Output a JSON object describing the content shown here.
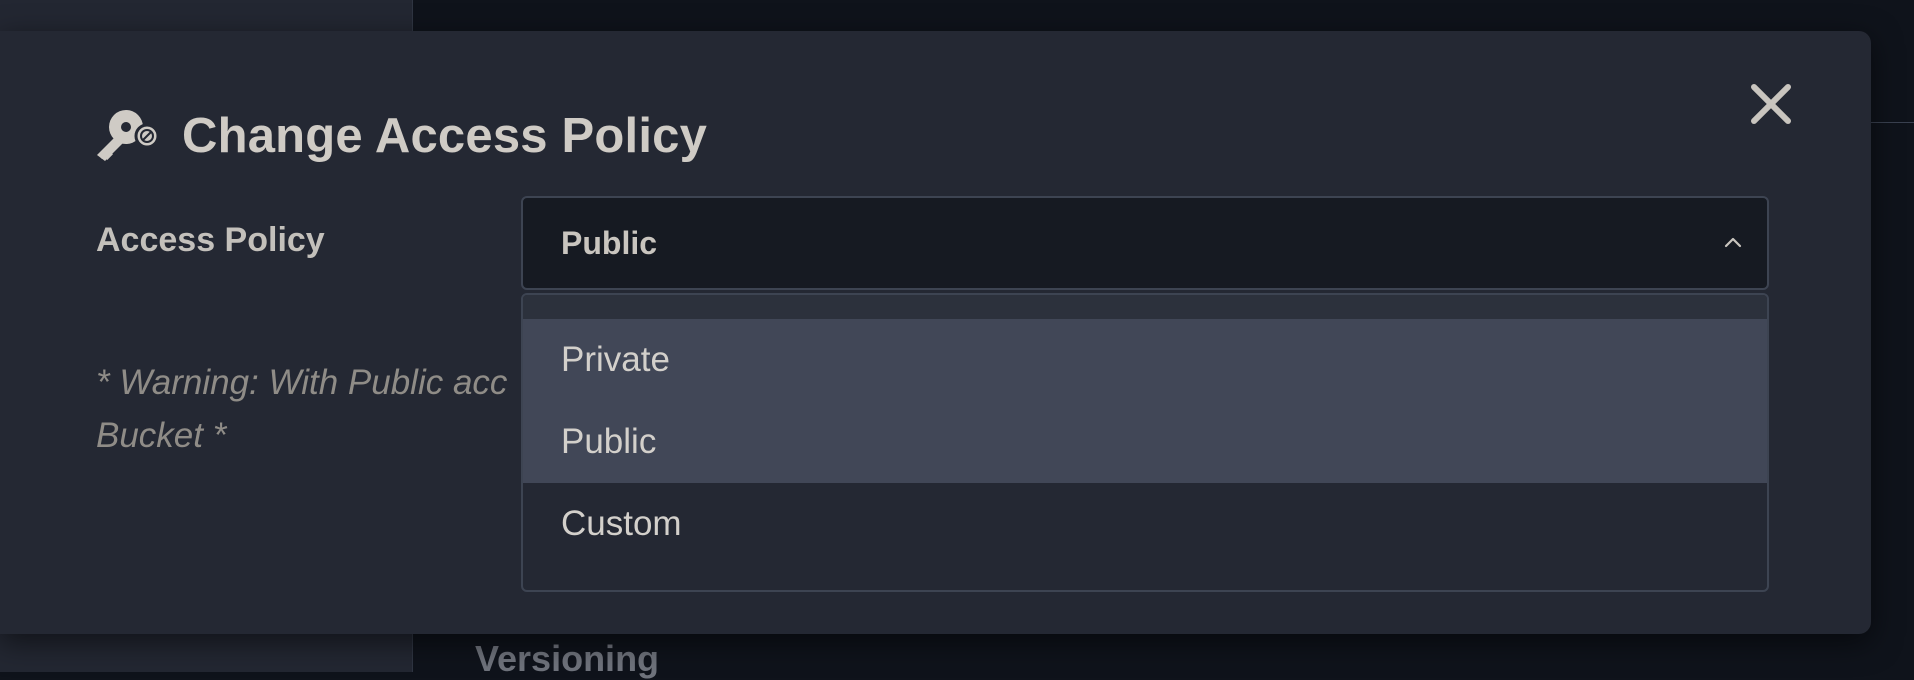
{
  "background": {
    "section_heading": "Versioning"
  },
  "modal": {
    "title": "Change Access Policy",
    "title_icon": "key-lock-icon",
    "close_icon": "close-icon",
    "field_label": "Access Policy",
    "warning": "* Warning: With Public acc",
    "warning_line2": "Bucket *"
  },
  "select": {
    "value": "Public",
    "options": [
      {
        "label": "Private",
        "highlighted": true
      },
      {
        "label": "Public",
        "highlighted": true
      },
      {
        "label": "Custom",
        "highlighted": false
      }
    ]
  },
  "colors": {
    "modal_bg": "#242833",
    "select_bg": "#161a22",
    "option_highlight": "#414757",
    "title_text": "#cfcbc5"
  }
}
